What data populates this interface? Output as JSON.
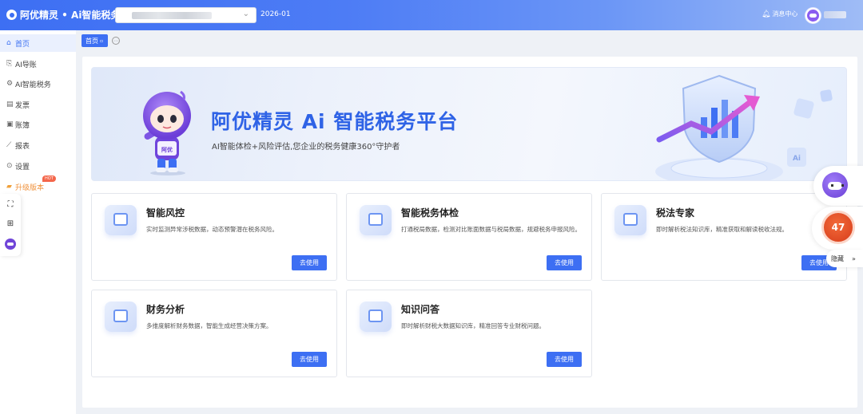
{
  "header": {
    "brand": "阿优精灵 • Ai智能税务",
    "period": "2026-01",
    "notify_label": "消息中心",
    "notify_icon": "bell-icon",
    "select_caret_icon": "chevron-down-icon"
  },
  "sidebar": {
    "items": [
      {
        "label": "首页",
        "icon": "home-icon"
      },
      {
        "label": "AI导账",
        "icon": "import-icon"
      },
      {
        "label": "AI智能税务",
        "icon": "gear-icon"
      },
      {
        "label": "发票",
        "icon": "invoice-icon"
      },
      {
        "label": "账簿",
        "icon": "ledger-icon"
      },
      {
        "label": "报表",
        "icon": "chart-icon"
      },
      {
        "label": "设置",
        "icon": "settings-icon"
      },
      {
        "label": "升级版本",
        "icon": "upgrade-icon",
        "badge": "HOT"
      }
    ]
  },
  "tabs": {
    "home_label": "首页"
  },
  "banner": {
    "title": "阿优精灵 Ai 智能税务平台",
    "subtitle": "AI智能体检+风险评估,您企业的税务健康360°守护者",
    "robot_tag": "阿优",
    "art_mark": "Ai"
  },
  "cards": [
    {
      "title": "智能风控",
      "desc": "实时监测异常涉税数据，动态预警潜在税务风险。",
      "button": "去使用",
      "icon": "monitor-icon"
    },
    {
      "title": "智能税务体检",
      "desc": "打通税局数据，检测对比账面数据与税局数据，规避税务申报风险。",
      "button": "去使用",
      "icon": "house-check-icon"
    },
    {
      "title": "税法专家",
      "desc": "即时解析税法知识库，精准获取和解读税收法规。",
      "button": "去使用",
      "icon": "experts-icon"
    },
    {
      "title": "财务分析",
      "desc": "多维度解析财务数据，智能生成经营决策方案。",
      "button": "去使用",
      "icon": "trend-chart-icon"
    },
    {
      "title": "知识问答",
      "desc": "即时解析财税大数据知识库，精准回答专业财税问题。",
      "button": "去使用",
      "icon": "chat-icon"
    }
  ],
  "right_float": {
    "score": "47",
    "hide_label": "隐藏",
    "hide_icon": "double-chevron-right-icon"
  },
  "colors": {
    "primary": "#3d6ff3",
    "score": "#e24a22",
    "upgrade": "#f0913a"
  }
}
